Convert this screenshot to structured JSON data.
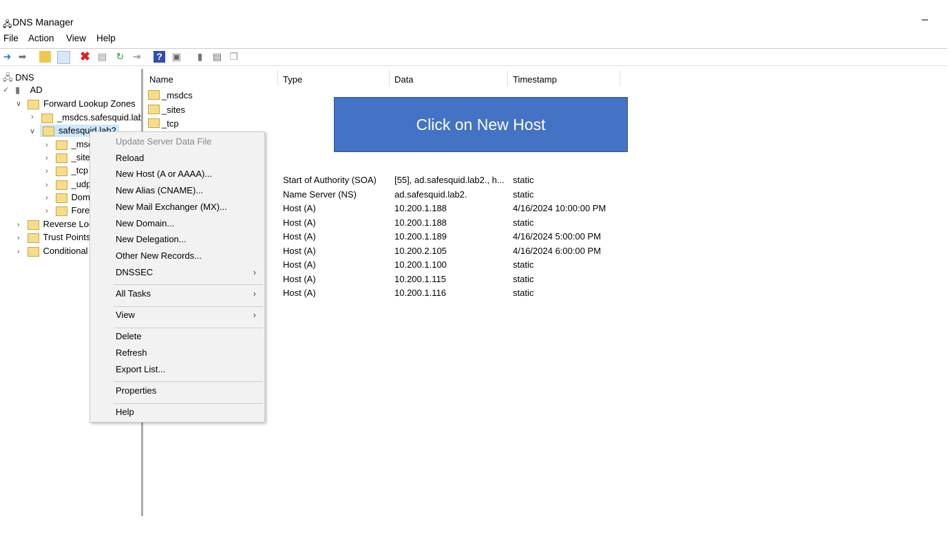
{
  "window": {
    "title": "DNS Manager",
    "minimize": "–"
  },
  "menubar": [
    "File",
    "Action",
    "View",
    "Help"
  ],
  "toolbar": {
    "icons": [
      "back-icon",
      "forward-icon",
      "up-folder-icon",
      "show-hide-tree-icon",
      "delete-icon",
      "properties-icon",
      "refresh-icon",
      "export-icon",
      "help-icon",
      "console-icon",
      "server-icon",
      "list-icon",
      "records-icon"
    ]
  },
  "tree": {
    "root": "DNS",
    "server": "AD",
    "flz": "Forward Lookup Zones",
    "msdcs_zone": "_msdcs.safesquid.lab",
    "zone": "safesquid.lab2",
    "children": [
      "_msc",
      "_site",
      "_tcp",
      "_udp",
      "Dom",
      "Fore"
    ],
    "others": [
      "Reverse Loo",
      "Trust Points",
      "Conditional"
    ]
  },
  "columns": [
    "Name",
    "Type",
    "Data",
    "Timestamp"
  ],
  "folders": [
    "_msdcs",
    "_sites",
    "_tcp"
  ],
  "records": [
    {
      "type": "Start of Authority (SOA)",
      "data": "[55], ad.safesquid.lab2., h...",
      "ts": "static"
    },
    {
      "type": "Name Server (NS)",
      "data": "ad.safesquid.lab2.",
      "ts": "static"
    },
    {
      "type": "Host (A)",
      "data": "10.200.1.188",
      "ts": "4/16/2024 10:00:00 PM"
    },
    {
      "type": "Host (A)",
      "data": "10.200.1.188",
      "ts": "static"
    },
    {
      "type": "Host (A)",
      "data": "10.200.1.189",
      "ts": "4/16/2024 5:00:00 PM"
    },
    {
      "type": "Host (A)",
      "data": "10.200.2.105",
      "ts": "4/16/2024 6:00:00 PM"
    },
    {
      "type": "Host (A)",
      "data": "10.200.1.100",
      "ts": "static"
    },
    {
      "type": "Host (A)",
      "data": "10.200.1.115",
      "ts": "static"
    },
    {
      "type": "Host (A)",
      "data": "10.200.1.116",
      "ts": "static"
    }
  ],
  "callout": "Click on New Host",
  "context_menu": [
    {
      "label": "Update Server Data File",
      "disabled": true
    },
    {
      "label": "Reload"
    },
    {
      "label": "New Host (A or AAAA)..."
    },
    {
      "label": "New Alias (CNAME)..."
    },
    {
      "label": "New Mail Exchanger (MX)..."
    },
    {
      "label": "New Domain..."
    },
    {
      "label": "New Delegation..."
    },
    {
      "label": "Other New Records..."
    },
    {
      "label": "DNSSEC",
      "submenu": true
    },
    {
      "label": "All Tasks",
      "submenu": true
    },
    {
      "label": "View",
      "submenu": true
    },
    {
      "label": "Delete"
    },
    {
      "label": "Refresh"
    },
    {
      "label": "Export List..."
    },
    {
      "label": "Properties"
    },
    {
      "label": "Help"
    }
  ]
}
